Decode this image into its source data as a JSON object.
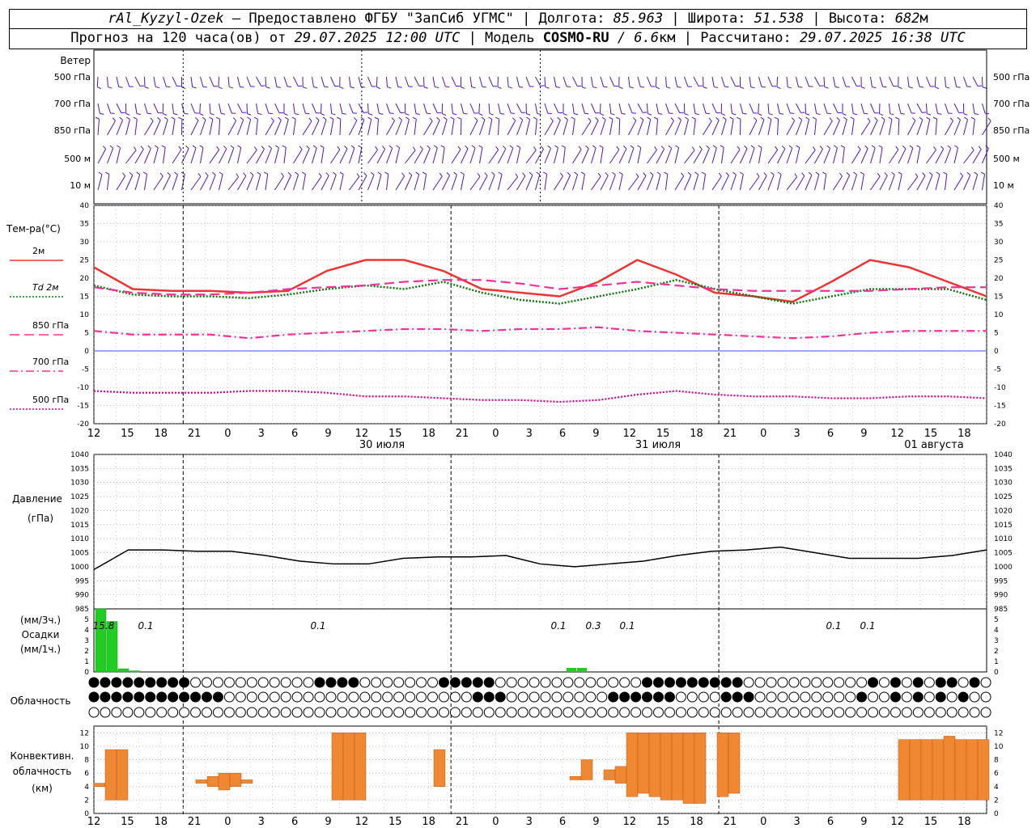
{
  "header": {
    "station": "rAl_Kyzyl-Ozek",
    "provided_by": " – Предоставлено ФГБУ \"ЗапСиб УГМС\" | ",
    "lon_label": "Долгота: ",
    "lon_value": "85.963",
    "lat_label": " | Широта: ",
    "lat_value": "51.538",
    "alt_label": " | Высота: ",
    "alt_value": "682",
    "alt_unit": "м",
    "forecast_label": "Прогноз на 120 часа(ов) от ",
    "forecast_start": "29.07.2025 12:00 UTC",
    "model_label": "  | Модель ",
    "model_name": "COSMO-RU",
    "model_res": " / 6.6",
    "model_res_unit": "км",
    "calc_label": " | Рассчитано: ",
    "calc_time": "29.07.2025 16:38 UTC"
  },
  "wind_panel": {
    "title": "Ветер",
    "levels": [
      "500 гПа",
      "700 гПа",
      "850 гПа",
      "500  м",
      "10   м"
    ]
  },
  "time_axis": {
    "hour_labels": [
      "12",
      "15",
      "18",
      "21",
      "0",
      "3",
      "6",
      "9",
      "12",
      "15",
      "18",
      "21",
      "0",
      "3",
      "6",
      "9",
      "12",
      "15",
      "18",
      "21",
      "0",
      "3",
      "6",
      "9",
      "12",
      "15",
      "18"
    ],
    "day_labels": [
      "30 июля",
      "31 июля",
      "01 августа"
    ]
  },
  "chart_data": [
    {
      "type": "line",
      "title": "Тем-ра(°C)",
      "ylim": [
        -20,
        40
      ],
      "y_ticks": [
        40,
        35,
        30,
        25,
        20,
        15,
        10,
        5,
        0,
        -5,
        -10,
        -15,
        -20
      ],
      "x_hours": [
        0,
        6,
        12,
        18,
        24,
        30,
        36,
        42,
        48,
        54,
        60,
        66,
        72,
        78,
        84,
        90,
        96,
        102,
        108,
        114,
        120
      ],
      "series": [
        {
          "name": "2м",
          "color": "#ee3333",
          "style": "solid",
          "values": [
            23,
            17,
            16.5,
            16.5,
            16,
            16.5,
            22,
            25,
            25,
            22,
            17,
            16,
            15,
            19,
            25,
            21,
            16,
            15,
            13.5,
            19,
            25,
            23,
            19,
            15
          ]
        },
        {
          "name": "Td  2м",
          "color": "#117711",
          "style": "dotted",
          "values": [
            18,
            15.5,
            15,
            15,
            14.5,
            15.5,
            17,
            18,
            17,
            19,
            16,
            14,
            13,
            15,
            17,
            19.5,
            17,
            15,
            13,
            15,
            17,
            17,
            17,
            14
          ]
        },
        {
          "name": "850 гПа",
          "color": "#ee3399",
          "style": "longdash",
          "values": [
            17.5,
            16,
            15.5,
            15.5,
            16,
            17,
            17.5,
            18,
            19,
            19.5,
            19.5,
            18.5,
            17,
            18,
            19,
            18,
            17,
            16.5,
            16.5,
            16.5,
            16.5,
            17,
            17.5,
            17.5
          ]
        },
        {
          "name": "700 гПа",
          "color": "#ee3399",
          "style": "dashdot",
          "values": [
            5.5,
            4.5,
            4.5,
            4.5,
            3.5,
            4.5,
            5,
            5.5,
            6,
            6,
            5.5,
            6,
            6,
            6.5,
            5.5,
            5,
            4.5,
            4,
            3.5,
            4,
            5,
            5.5,
            5.5,
            5.5
          ]
        },
        {
          "name": "500 гПа",
          "color": "#dd0088",
          "style": "dotted",
          "values": [
            -11,
            -11.5,
            -11.5,
            -11.5,
            -11,
            -11,
            -11.5,
            -12.5,
            -12.5,
            -13,
            -13.5,
            -13.5,
            -14,
            -13.5,
            -12,
            -11,
            -12,
            -12.5,
            -12.5,
            -13,
            -13,
            -12.5,
            -12.5,
            -13
          ]
        }
      ]
    },
    {
      "type": "line",
      "title": "Давление",
      "unit": "(гПа)",
      "ylim": [
        985,
        1040
      ],
      "y_ticks": [
        1040,
        1035,
        1030,
        1025,
        1020,
        1015,
        1010,
        1005,
        1000,
        995,
        990,
        985
      ],
      "series": [
        {
          "name": "",
          "color": "#000000",
          "values": [
            999,
            1006,
            1006,
            1005.5,
            1005.5,
            1004,
            1002,
            1001,
            1001,
            1003,
            1003.5,
            1003.5,
            1004,
            1001,
            1000,
            1001,
            1002,
            1004,
            1005.5,
            1006,
            1007,
            1005,
            1003,
            1003,
            1003,
            1004,
            1006
          ]
        }
      ]
    },
    {
      "type": "bar",
      "title": "(мм/3ч.)",
      "subtitle": "Осадки",
      "unit": "(мм/1ч.)",
      "ylim": [
        0,
        6
      ],
      "y_ticks": [
        5,
        4,
        3,
        2,
        1,
        0
      ],
      "bar_values_3h": [
        6.0,
        4.8,
        0.3,
        0.1
      ],
      "labels": [
        "15.8",
        "0.1",
        "0.1",
        "0.1",
        "0.3",
        "0.1",
        "0.1",
        "0.1"
      ]
    },
    {
      "type": "table",
      "title": "Облачность",
      "rows": 3
    },
    {
      "type": "bar",
      "title": "Конвективн.",
      "subtitle": "облачность",
      "unit": "(км)",
      "ylim": [
        0,
        13
      ],
      "y_ticks": [
        12,
        10,
        8,
        6,
        4,
        2,
        0
      ],
      "color": "#ee8833",
      "bars": [
        [
          0,
          4,
          4.5
        ],
        [
          1,
          2,
          9.5
        ],
        [
          2,
          2,
          9.5
        ],
        [
          9,
          4.5,
          5
        ],
        [
          10,
          4,
          5.5
        ],
        [
          11,
          3.5,
          6
        ],
        [
          12,
          4,
          6
        ],
        [
          13,
          4.5,
          5
        ],
        [
          21,
          2,
          12
        ],
        [
          22,
          2,
          12
        ],
        [
          23,
          2,
          12
        ],
        [
          30,
          4,
          9.5
        ],
        [
          42,
          5,
          5.5
        ],
        [
          43,
          5,
          8
        ],
        [
          45,
          5,
          6.5
        ],
        [
          46,
          4.5,
          7
        ],
        [
          47,
          2.5,
          12
        ],
        [
          48,
          3,
          12
        ],
        [
          49,
          2.5,
          12
        ],
        [
          50,
          2,
          12
        ],
        [
          51,
          2,
          12
        ],
        [
          52,
          1.5,
          12
        ],
        [
          53,
          1.5,
          12
        ],
        [
          55,
          2.5,
          12
        ],
        [
          56,
          3,
          12
        ],
        [
          71,
          2,
          11
        ],
        [
          72,
          2,
          11
        ],
        [
          73,
          2,
          11
        ],
        [
          74,
          2,
          11
        ],
        [
          75,
          2,
          11.5
        ],
        [
          76,
          2,
          11
        ],
        [
          77,
          2,
          11
        ],
        [
          78,
          2,
          11
        ]
      ]
    }
  ]
}
